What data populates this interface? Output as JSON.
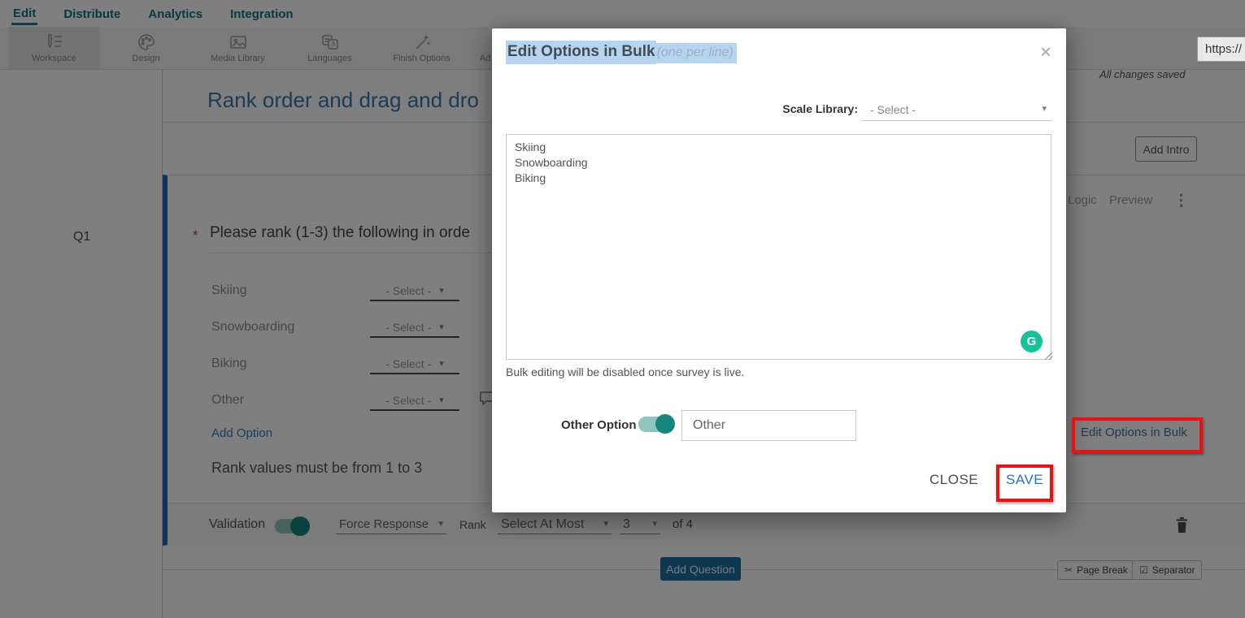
{
  "nav": {
    "items": [
      {
        "label": "Edit"
      },
      {
        "label": "Distribute"
      },
      {
        "label": "Analytics"
      },
      {
        "label": "Integration"
      }
    ]
  },
  "toolbar": {
    "items": [
      {
        "label": "Workspace",
        "icon": "workspace-pen-icon"
      },
      {
        "label": "Design",
        "icon": "palette-icon"
      },
      {
        "label": "Media Library",
        "icon": "image-icon"
      },
      {
        "label": "Languages",
        "icon": "translate-icon"
      },
      {
        "label": "Finish Options",
        "icon": "wand-icon"
      },
      {
        "label": "Ad",
        "icon": "partial-hidden-icon"
      }
    ],
    "saved_status": "All changes saved",
    "url_value": "https://"
  },
  "sidebar": {
    "question_number": "Q1"
  },
  "main": {
    "survey_title": "Rank order and drag and dro",
    "add_intro_label": "Add Intro",
    "question": {
      "logic_label": "Logic",
      "preview_label": "Preview",
      "required_marker": "*",
      "text": "Please rank (1-3) the following in orde",
      "options": [
        {
          "label": "Skiing",
          "value": "- Select -"
        },
        {
          "label": "Snowboarding",
          "value": "- Select -"
        },
        {
          "label": "Biking",
          "value": "- Select -"
        },
        {
          "label": "Other",
          "value": "- Select -"
        }
      ],
      "add_option_label": "Add Option",
      "rank_note": "Rank values must be from 1 to 3",
      "edit_bulk_label": "Edit Options in Bulk"
    },
    "validation": {
      "label": "Validation",
      "force_response_value": "Force Response",
      "rank_label": "Rank",
      "at_most_value": "Select At Most",
      "count_value": "3",
      "of_label": "of 4"
    },
    "footer": {
      "add_question_label": "Add Question",
      "page_break_label": "Page Break",
      "separator_label": "Separator"
    }
  },
  "modal": {
    "title": "Edit Options in Bulk",
    "title_hint": "(one per line)",
    "scale_library_label": "Scale Library:",
    "scale_library_value": "- Select -",
    "bulk_text": "Skiing\nSnowboarding\nBiking",
    "note": "Bulk editing will be disabled once survey is live.",
    "other_option_label": "Other Option",
    "other_value": "Other",
    "close_label": "CLOSE",
    "save_label": "SAVE"
  },
  "icons": {
    "caret": "▾",
    "menu": "⋮",
    "close": "✕",
    "page_break": "✂",
    "separator": "☑",
    "grammarly": "G"
  },
  "colors": {
    "nav_teal": "#0d7284",
    "title_blue": "#3778a9",
    "link_blue": "#2f7db8",
    "card_accent_blue": "#1f6cb5",
    "add_question_blue": "#1d6fa5",
    "save_blue": "#2273d1",
    "annotation_red": "#ee0f0f",
    "toggle_teal": "#17867c",
    "toggle_track": "#8cc7c0",
    "grammarly_green": "#15c39a",
    "selection_blue": "#b5d4f0"
  }
}
